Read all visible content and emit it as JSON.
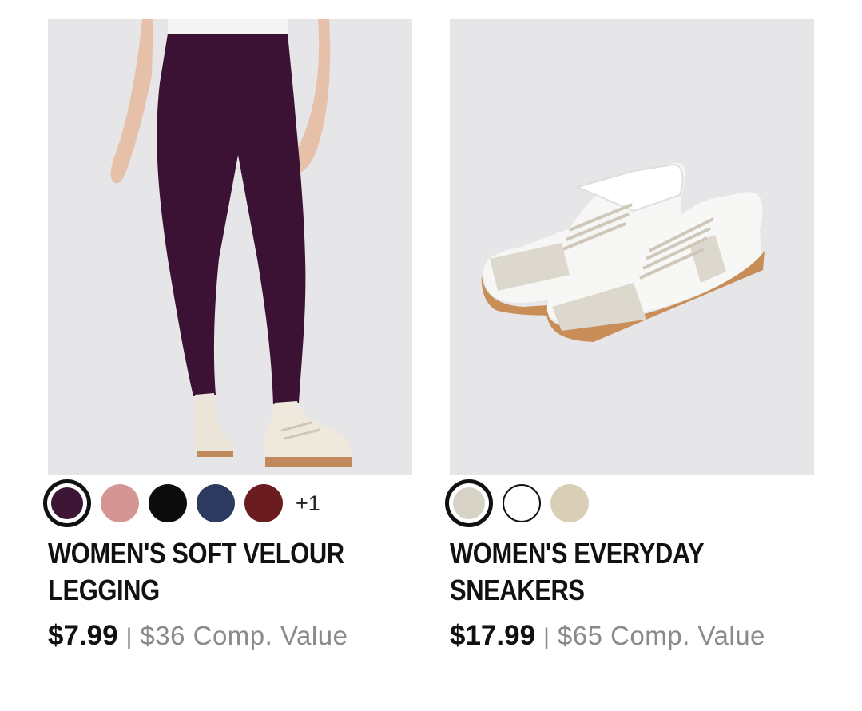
{
  "products": [
    {
      "image_alt": "",
      "swatches": [
        {
          "color": "#3d1535",
          "selected": true
        },
        {
          "color": "#d49593",
          "selected": false
        },
        {
          "color": "#0c0c0c",
          "selected": false
        },
        {
          "color": "#2c3a5f",
          "selected": false
        },
        {
          "color": "#6a1c1f",
          "selected": false
        }
      ],
      "more_colors": "+1",
      "title": "WOMEN'S SOFT VELOUR LEGGING",
      "price": "$7.99",
      "separator": "|",
      "comp_value": "$36 Comp. Value"
    },
    {
      "image_alt": "",
      "swatches": [
        {
          "color": "#d7d2c6",
          "selected": true
        },
        {
          "color": "#ffffff",
          "selected": false,
          "outlined": true
        },
        {
          "color": "#d9cfb6",
          "selected": false
        }
      ],
      "title": "WOMEN'S EVERYDAY SNEAKERS",
      "price": "$17.99",
      "separator": "|",
      "comp_value": "$65 Comp. Value"
    }
  ],
  "colors": {
    "image_bg": "#e6e6e8",
    "legging": "#3b1233",
    "skin": "#e9c3ae",
    "sole": "#c98e58",
    "suede": "#dcd8ce"
  }
}
